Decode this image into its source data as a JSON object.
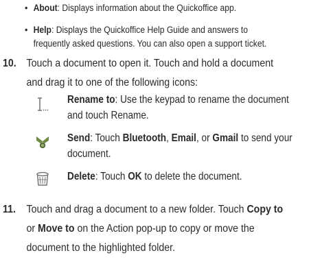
{
  "bullets": [
    {
      "term": "About",
      "text": ": Displays information about the Quickoffice app."
    },
    {
      "term": "Help",
      "text_line1": ": Displays the Quickoffice Help Guide and answers to",
      "text_line2": "frequently asked questions. You can also open a support ticket."
    }
  ],
  "step10": {
    "number": "10.",
    "line1": "Touch a document to open it. Touch and hold a document",
    "line2": "and drag it to one of the following icons:"
  },
  "icons": [
    {
      "icon": "rename-icon",
      "term": "Rename to",
      "line1": ": Use the keypad to rename the document",
      "line2": "and touch Rename."
    },
    {
      "icon": "send-icon",
      "term": "Send",
      "p1": ": Touch ",
      "b1": "Bluetooth",
      "p2": ", ",
      "b2": "Email",
      "p3": ", or ",
      "b3": "Gmail",
      "p4": " to send your",
      "line2": "document."
    },
    {
      "icon": "trash-icon",
      "term": "Delete",
      "p1": ": Touch ",
      "b1": "OK",
      "p2": " to delete the document."
    }
  ],
  "step11": {
    "number": "11.",
    "l1a": "Touch and drag a document to a new folder. Touch ",
    "l1b": "Copy to",
    "l2a": "or ",
    "l2b": "Move to",
    "l2c": " on the Action pop-up to copy or move the",
    "l3": "document to the highlighted folder."
  },
  "colors": {
    "text": "#2a2a2a",
    "icon_green": "#6f8b45",
    "icon_gray": "#707070"
  }
}
